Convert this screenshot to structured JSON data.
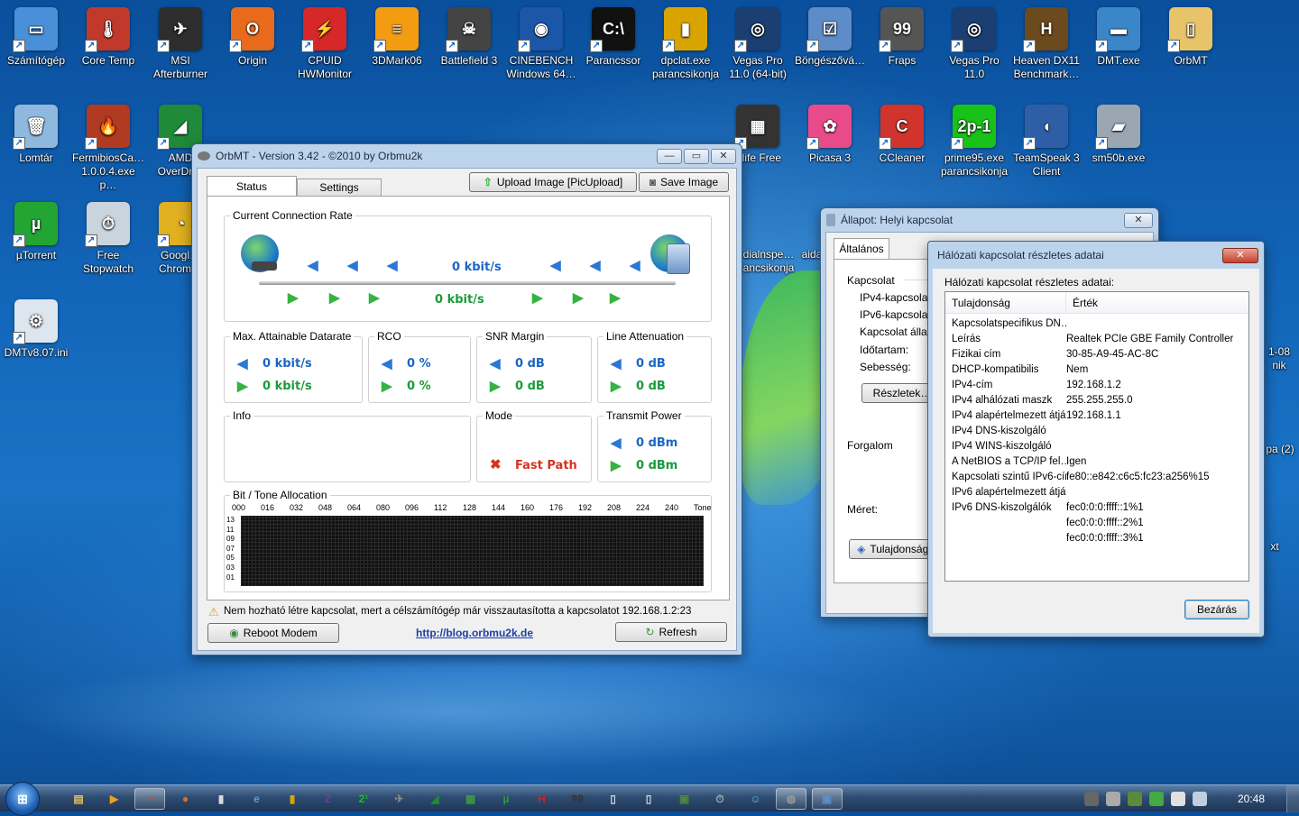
{
  "desktop": {
    "icons_row1": [
      {
        "label": "Számítógép",
        "color": "#4a90d9",
        "glyph": "▭"
      },
      {
        "label": "Core Temp",
        "color": "#c0392b",
        "glyph": "🌡"
      },
      {
        "label": "MSI Afterburner",
        "color": "#2d2d2d",
        "glyph": "✈"
      },
      {
        "label": "Origin",
        "color": "#e86a1c",
        "glyph": "O"
      },
      {
        "label": "CPUID HWMonitor",
        "color": "#d62828",
        "glyph": "⚡"
      },
      {
        "label": "3DMark06",
        "color": "#f39c12",
        "glyph": "≡"
      },
      {
        "label": "Battlefield 3",
        "color": "#444",
        "glyph": "☠"
      },
      {
        "label": "CINEBENCH Windows 64…",
        "color": "#1c56a8",
        "glyph": "◉"
      },
      {
        "label": "Parancssor",
        "color": "#111",
        "glyph": "C:\\"
      },
      {
        "label": "dpclat.exe parancsikonja",
        "color": "#d9a400",
        "glyph": "▮"
      },
      {
        "label": "Vegas Pro 11.0 (64-bit)",
        "color": "#1b3f73",
        "glyph": "◎"
      },
      {
        "label": "Böngészővá…",
        "color": "#5d8cc9",
        "glyph": "☑"
      },
      {
        "label": "Fraps",
        "color": "#555",
        "glyph": "99"
      },
      {
        "label": "Vegas Pro 11.0",
        "color": "#1b3f73",
        "glyph": "◎"
      },
      {
        "label": "Heaven DX11 Benchmark…",
        "color": "#6b4a1e",
        "glyph": "H"
      },
      {
        "label": "DMT.exe",
        "color": "#3a86c8",
        "glyph": "▬"
      },
      {
        "label": "OrbMT",
        "color": "#e7c46a",
        "glyph": "▯"
      }
    ],
    "icons_row2": [
      {
        "label": "Lomtár",
        "color": "#8fb8de",
        "glyph": "🗑"
      },
      {
        "label": "FermibiosCa… 1.0.0.4.exe p…",
        "color": "#b13a22",
        "glyph": "🔥"
      },
      {
        "label": "AMD OverDr…",
        "color": "#1e8a3a",
        "glyph": "◢"
      },
      {
        "label": "Dlife Free",
        "color": "#333",
        "glyph": "▦"
      },
      {
        "label": "Picasa 3",
        "color": "#e94b8a",
        "glyph": "✿"
      },
      {
        "label": "CCleaner",
        "color": "#d0342c",
        "glyph": "C"
      },
      {
        "label": "prime95.exe parancsikonja",
        "color": "#19c219",
        "glyph": "2p-1"
      },
      {
        "label": "TeamSpeak 3 Client",
        "color": "#2e5fa6",
        "glyph": "◖"
      },
      {
        "label": "sm50b.exe",
        "color": "#9aa6b2",
        "glyph": "▰"
      }
    ],
    "icons_col": [
      {
        "label": "µTorrent",
        "color": "#22a532",
        "glyph": "µ"
      },
      {
        "label": "Free Stopwatch",
        "color": "#c9d4dd",
        "glyph": "⏱"
      },
      {
        "label": "Googl… Chrom…",
        "color": "#e0b020",
        "glyph": "◔"
      },
      {
        "label": "DMTv8.07.ini",
        "color": "#dde6ee",
        "glyph": "⚙"
      }
    ],
    "partial_labels": [
      "dialnspe… ancsikonja",
      "aida",
      "1-08 nik",
      "pa (2)",
      "xt"
    ]
  },
  "orbmt": {
    "title": "OrbMT - Version 3.42 - ©2010 by Orbmu2k",
    "tabs": [
      "Status",
      "Settings"
    ],
    "upload_button": "Upload Image [PicUpload]",
    "save_button": "Save Image",
    "connection_rate": {
      "label": "Current Connection Rate",
      "down": "0 kbit/s",
      "up": "0 kbit/s"
    },
    "max_datarate": {
      "label": "Max. Attainable Datarate",
      "down": "0 kbit/s",
      "up": "0 kbit/s"
    },
    "rco": {
      "label": "RCO",
      "down": "0 %",
      "up": "0 %"
    },
    "snr": {
      "label": "SNR Margin",
      "down": "0 dB",
      "up": "0 dB"
    },
    "attenuation": {
      "label": "Line Attenuation",
      "down": "0 dB",
      "up": "0 dB"
    },
    "info": {
      "label": "Info"
    },
    "mode": {
      "label": "Mode",
      "value": "Fast Path"
    },
    "transmit": {
      "label": "Transmit Power",
      "down": "0 dBm",
      "up": "0 dBm"
    },
    "bit_tone": {
      "label": "Bit / Tone Allocation",
      "x_ticks": [
        "000",
        "016",
        "032",
        "048",
        "064",
        "080",
        "096",
        "112",
        "128",
        "144",
        "160",
        "176",
        "192",
        "208",
        "224",
        "240",
        "Tone"
      ],
      "y_ticks": [
        "13",
        "11",
        "09",
        "07",
        "05",
        "03",
        "01"
      ]
    },
    "status_message": "Nem hozható létre kapcsolat, mert a célszámítógép már visszautasította a kapcsolatot 192.168.1.2:23",
    "reboot_button": "Reboot Modem",
    "link": "http://blog.orbmu2k.de",
    "refresh_button": "Refresh"
  },
  "allapot": {
    "title": "Állapot: Helyi kapcsolat",
    "tab": "Általános",
    "section_connection": "Kapcsolat",
    "rows": [
      "IPv4-kapcsolat:",
      "IPv6-kapcsolat:",
      "Kapcsolat állapo",
      "Időtartam:",
      "Sebesség:"
    ],
    "details_button": "Részletek…",
    "section_traffic": "Forgalom",
    "size_label": "Méret:",
    "properties_button": "Tulajdonságok"
  },
  "details": {
    "title": "Hálózati kapcsolat részletes adatai",
    "subtitle": "Hálózati kapcsolat részletes adatai:",
    "col_property": "Tulajdonság",
    "col_value": "Érték",
    "rows": [
      {
        "k": "Kapcsolatspecifikus DN…",
        "v": ""
      },
      {
        "k": "Leírás",
        "v": "Realtek PCIe GBE Family Controller"
      },
      {
        "k": "Fizikai cím",
        "v": "30-85-A9-45-AC-8C"
      },
      {
        "k": "DHCP-kompatibilis",
        "v": "Nem"
      },
      {
        "k": "IPv4-cím",
        "v": "192.168.1.2"
      },
      {
        "k": "IPv4 alhálózati maszk",
        "v": "255.255.255.0"
      },
      {
        "k": "IPv4 alapértelmezett átjáró",
        "v": "192.168.1.1"
      },
      {
        "k": "IPv4 DNS-kiszolgáló",
        "v": ""
      },
      {
        "k": "IPv4 WINS-kiszolgáló",
        "v": ""
      },
      {
        "k": "A NetBIOS a TCP/IP fel…",
        "v": "Igen"
      },
      {
        "k": "Kapcsolati szintű IPv6-cím",
        "v": "fe80::e842:c6c5:fc23:a256%15"
      },
      {
        "k": "IPv6 alapértelmezett átjáró",
        "v": ""
      },
      {
        "k": "IPv6 DNS-kiszolgálók",
        "v": "fec0:0:0:ffff::1%1"
      },
      {
        "k": "",
        "v": "fec0:0:0:ffff::2%1"
      },
      {
        "k": "",
        "v": "fec0:0:0:ffff::3%1"
      }
    ],
    "close_button": "Bezárás"
  },
  "taskbar": {
    "items": [
      {
        "name": "explorer",
        "glyph": "▤",
        "color": "#e8c15a"
      },
      {
        "name": "media",
        "glyph": "▶",
        "color": "#f0a020"
      },
      {
        "name": "chrome",
        "glyph": "◔",
        "color": "#e04a2a"
      },
      {
        "name": "origin",
        "glyph": "●",
        "color": "#e86a1c"
      },
      {
        "name": "coretemp",
        "glyph": "▮",
        "color": "#d9d9d9"
      },
      {
        "name": "ie",
        "glyph": "e",
        "color": "#4ea3e8"
      },
      {
        "name": "dpclat",
        "glyph": "▮",
        "color": "#d9a400"
      },
      {
        "name": "zcpu",
        "glyph": "Z",
        "color": "#6b3fa0"
      },
      {
        "name": "prime95",
        "glyph": "2¹",
        "color": "#19c219"
      },
      {
        "name": "msi",
        "glyph": "✈",
        "color": "#888"
      },
      {
        "name": "amd",
        "glyph": "◢",
        "color": "#1e8a3a"
      },
      {
        "name": "gpu",
        "glyph": "▦",
        "color": "#3c9a3c"
      },
      {
        "name": "utorrent",
        "glyph": "µ",
        "color": "#22a532"
      },
      {
        "name": "heaven",
        "glyph": "H",
        "color": "#c0282c"
      },
      {
        "name": "fraps",
        "glyph": "99",
        "color": "#333"
      },
      {
        "name": "notepad",
        "glyph": "▯",
        "color": "#cfd8e2"
      },
      {
        "name": "file",
        "glyph": "▯",
        "color": "#cfd8e2"
      },
      {
        "name": "display",
        "glyph": "▣",
        "color": "#4b8a3a"
      },
      {
        "name": "stopwatch",
        "glyph": "⏱",
        "color": "#9aa"
      },
      {
        "name": "users",
        "glyph": "☺",
        "color": "#6ab0e8"
      },
      {
        "name": "orbmt",
        "glyph": "◍",
        "color": "#999"
      },
      {
        "name": "network",
        "glyph": "▣",
        "color": "#5b8fc9"
      }
    ],
    "clock": "20:48"
  }
}
